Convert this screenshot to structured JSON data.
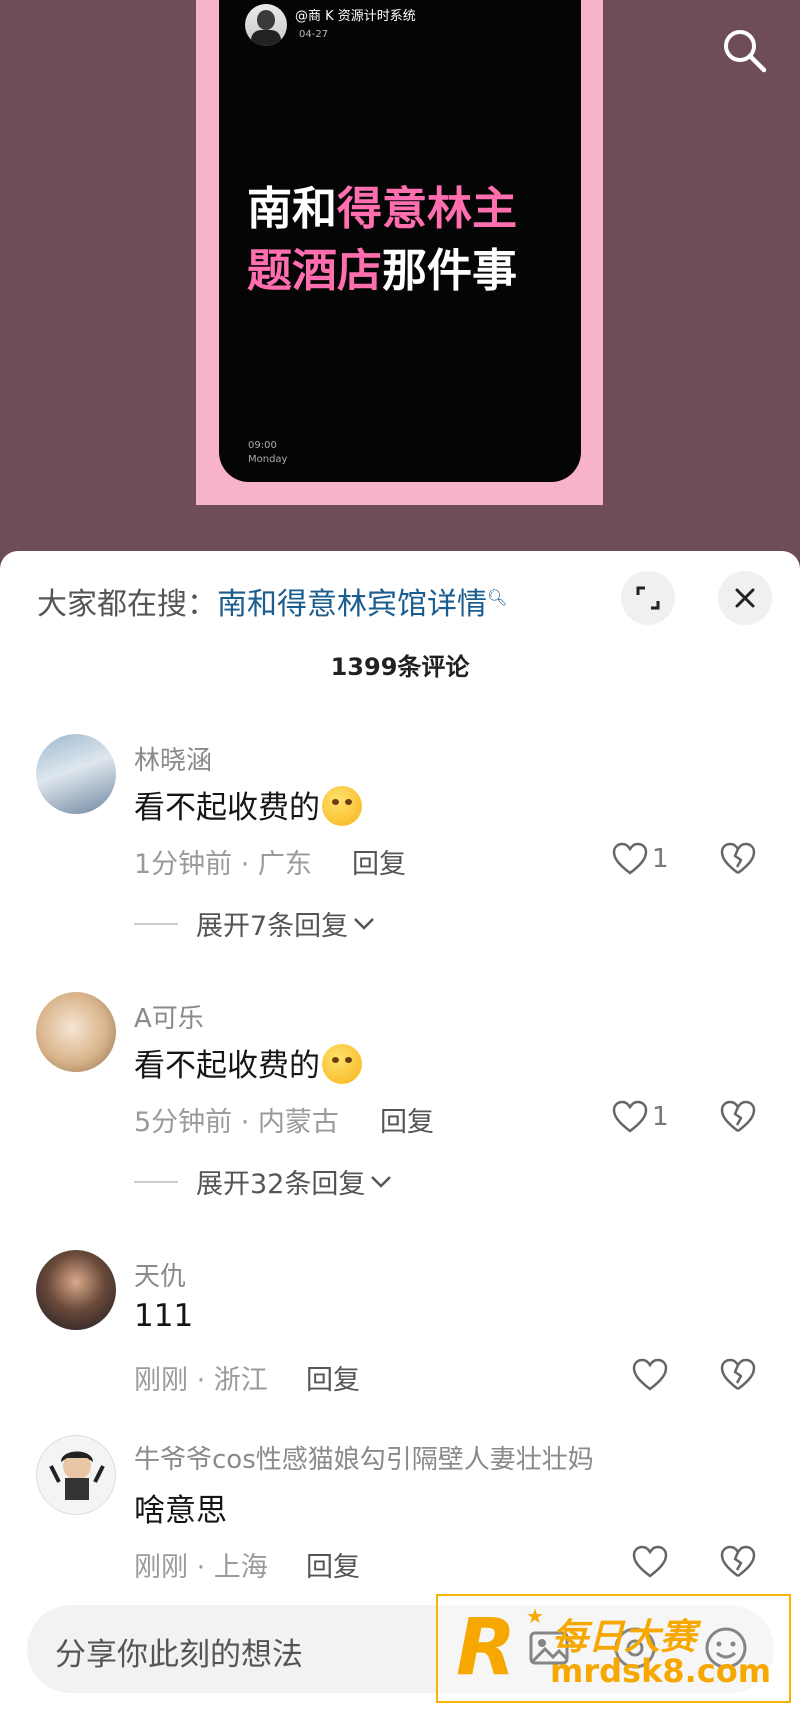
{
  "video": {
    "author": "@商 K 资源计时系统",
    "date": "04-27",
    "title_white_1": "南和",
    "title_pink_1": "得意林主",
    "title_pink_2": "题酒店",
    "title_white_2": "那件事",
    "clock": "09:00",
    "weekday": "Monday"
  },
  "sheet": {
    "hot_search_prefix": "大家都在搜：",
    "hot_search_link": "南和得意林宾馆详情",
    "comment_count": "1399条评论"
  },
  "comments": [
    {
      "name": "林晓涵",
      "text": "看不起收费的",
      "meta": "1分钟前 · 广东",
      "reply": "回复",
      "likes": "1",
      "expand": "展开7条回复"
    },
    {
      "name": "A可乐",
      "text": "看不起收费的",
      "meta": "5分钟前 · 内蒙古",
      "reply": "回复",
      "likes": "1",
      "expand": "展开32条回复"
    },
    {
      "name": "天仇",
      "text": "111",
      "meta": "刚刚 · 浙江",
      "reply": "回复"
    },
    {
      "name": "牛爷爷cos性感猫娘勾引隔壁人妻壮壮妈",
      "text": "啥意思",
      "meta": "刚刚 · 上海",
      "reply": "回复"
    }
  ],
  "input": {
    "placeholder": "分享你此刻的想法"
  },
  "watermark": {
    "logo": "R",
    "title": "每日大赛",
    "url": "mrdsk8.com"
  },
  "colors": {
    "accent_pink": "#ff6fb0",
    "link_blue": "#1c5d8f",
    "watermark_orange": "#f7a800",
    "backdrop": "#6e4d58"
  }
}
